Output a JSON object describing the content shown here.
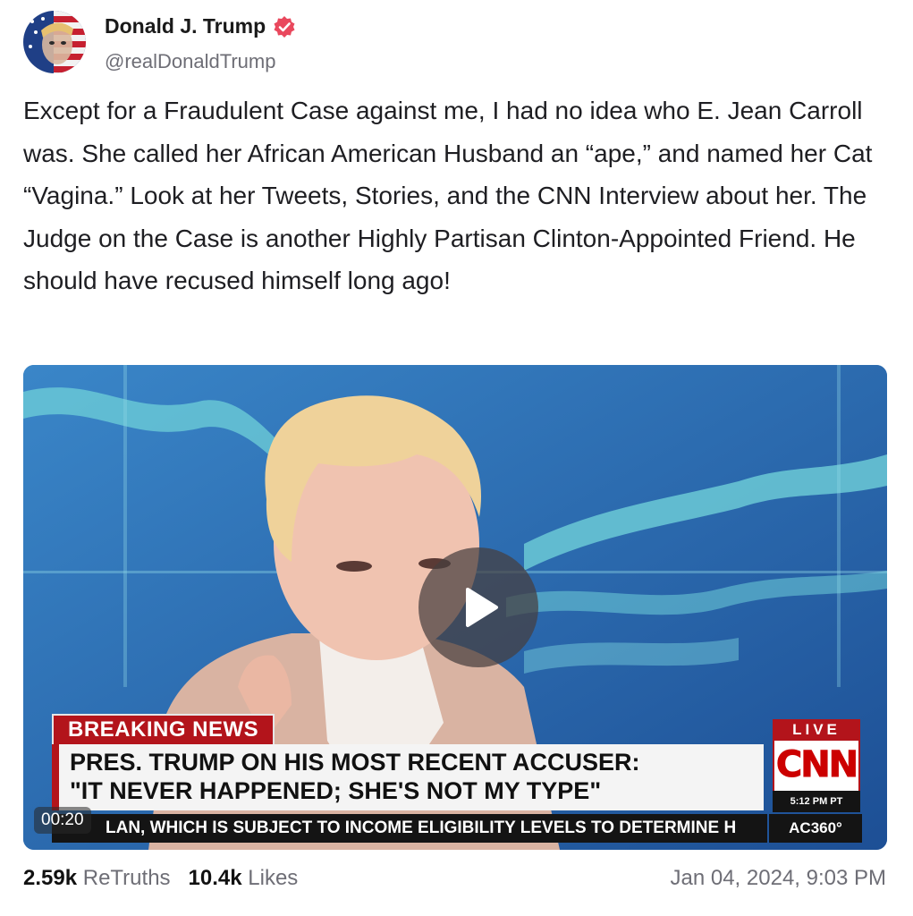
{
  "author": {
    "display_name": "Donald J. Trump",
    "handle": "@realDonaldTrump",
    "verified_color": "#e9485d"
  },
  "post": {
    "text": "Except for a Fraudulent Case against me, I had no idea who E. Jean Carroll was. She called her African American Husband an “ape,” and named her Cat “Vagina.” Look at her Tweets, Stories, and the CNN Interview about her. The Judge on the Case is another Highly Partisan Clinton-Appointed Friend. He should have recused himself long ago!"
  },
  "video": {
    "timestamp": "00:20",
    "breaking_label": "BREAKING NEWS",
    "headline_line1": "PRES. TRUMP ON HIS MOST RECENT ACCUSER:",
    "headline_line2": "\"IT NEVER HAPPENED; SHE'S NOT MY TYPE\"",
    "ticker": "LAN, WHICH IS SUBJECT TO INCOME ELIGIBILITY LEVELS TO DETERMINE H",
    "live_label": "LIVE",
    "network_logo": "CNN",
    "broadcast_time": "5:12 PM PT",
    "show_label": "AC360°",
    "play_icon": "play-icon"
  },
  "stats": {
    "retruths_count": "2.59k",
    "retruths_label": "ReTruths",
    "likes_count": "10.4k",
    "likes_label": "Likes"
  },
  "date": "Jan 04, 2024, 9:03 PM",
  "colors": {
    "cnn_red": "#b3141b",
    "text_muted": "#6e6e76"
  }
}
